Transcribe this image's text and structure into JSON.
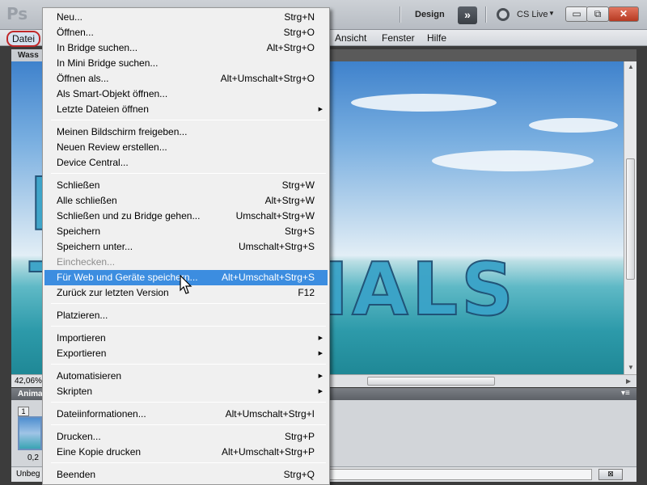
{
  "app": {
    "logo": "Ps",
    "workspace_label": "Design",
    "workspace_button": "»",
    "cslive_label": "CS Live",
    "cslive_arrow": "▼"
  },
  "window_controls": {
    "minimize": "▭",
    "restore": "⧉",
    "close": "✕"
  },
  "menubar": [
    "Datei",
    "Ansicht",
    "Fenster",
    "Hilfe"
  ],
  "document": {
    "tab_label": "Wass",
    "watermark_text": "PSD-TUTORIALS",
    "zoom": "42,06%"
  },
  "panel": {
    "title": "Anima",
    "menu_icon": "▾≡",
    "frame_number": "1",
    "frame_time": "0,2",
    "status_text": "Unbeg",
    "status_icon": "⊠"
  },
  "menu": {
    "highlight_color": "#3c8de0",
    "items": [
      {
        "label": "Neu...",
        "shortcut": "Strg+N"
      },
      {
        "label": "Öffnen...",
        "shortcut": "Strg+O"
      },
      {
        "label": "In Bridge suchen...",
        "shortcut": "Alt+Strg+O"
      },
      {
        "label": "In Mini Bridge suchen...",
        "shortcut": ""
      },
      {
        "label": "Öffnen als...",
        "shortcut": "Alt+Umschalt+Strg+O"
      },
      {
        "label": "Als Smart-Objekt öffnen...",
        "shortcut": ""
      },
      {
        "label": "Letzte Dateien öffnen",
        "shortcut": "",
        "submenu": "▶"
      },
      {
        "label": "Meinen Bildschirm freigeben...",
        "shortcut": ""
      },
      {
        "label": "Neuen Review erstellen...",
        "shortcut": ""
      },
      {
        "label": "Device Central...",
        "shortcut": ""
      },
      {
        "label": "Schließen",
        "shortcut": "Strg+W"
      },
      {
        "label": "Alle schließen",
        "shortcut": "Alt+Strg+W"
      },
      {
        "label": "Schließen und zu Bridge gehen...",
        "shortcut": "Umschalt+Strg+W"
      },
      {
        "label": "Speichern",
        "shortcut": "Strg+S"
      },
      {
        "label": "Speichern unter...",
        "shortcut": "Umschalt+Strg+S"
      },
      {
        "label": "Einchecken...",
        "shortcut": "",
        "disabled": true
      },
      {
        "label": "Für Web und Geräte speichern...",
        "shortcut": "Alt+Umschalt+Strg+S",
        "highlighted": true
      },
      {
        "label": "Zurück zur letzten Version",
        "shortcut": "F12"
      },
      {
        "label": "Platzieren...",
        "shortcut": ""
      },
      {
        "label": "Importieren",
        "shortcut": "",
        "submenu": "▶"
      },
      {
        "label": "Exportieren",
        "shortcut": "",
        "submenu": "▶"
      },
      {
        "label": "Automatisieren",
        "shortcut": "",
        "submenu": "▶"
      },
      {
        "label": "Skripten",
        "shortcut": "",
        "submenu": "▶"
      },
      {
        "label": "Dateiinformationen...",
        "shortcut": "Alt+Umschalt+Strg+I"
      },
      {
        "label": "Drucken...",
        "shortcut": "Strg+P"
      },
      {
        "label": "Eine Kopie drucken",
        "shortcut": "Alt+Umschalt+Strg+P"
      },
      {
        "label": "Beenden",
        "shortcut": "Strg+Q"
      }
    ]
  }
}
